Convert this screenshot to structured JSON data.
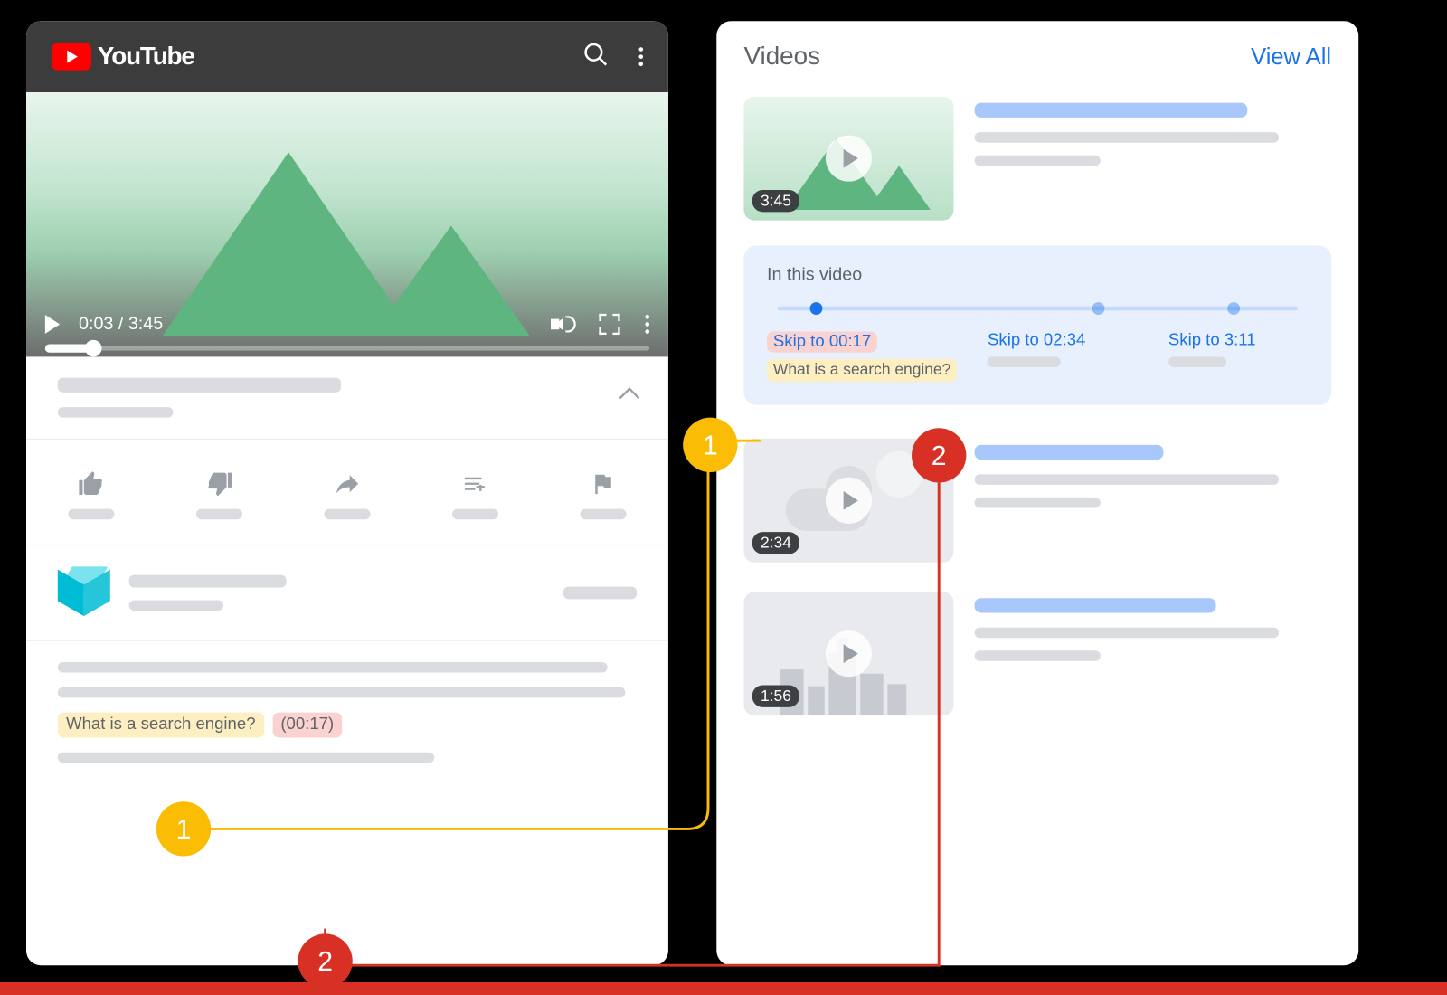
{
  "youtube": {
    "brand": "YouTube",
    "time": "0:03 / 3:45",
    "description": {
      "chapter_label": "What is a search engine?",
      "chapter_time": "(00:17)"
    }
  },
  "search": {
    "heading": "Videos",
    "view_all": "View All",
    "videos": [
      {
        "duration": "3:45"
      },
      {
        "duration": "2:34"
      },
      {
        "duration": "1:56"
      }
    ],
    "chapters": {
      "heading": "In this video",
      "items": [
        {
          "skip": "Skip to 00:17",
          "desc": "What is a search engine?"
        },
        {
          "skip": "Skip to 02:34"
        },
        {
          "skip": "Skip to 3:11"
        }
      ]
    }
  },
  "annotations": {
    "one": "1",
    "two": "2"
  }
}
